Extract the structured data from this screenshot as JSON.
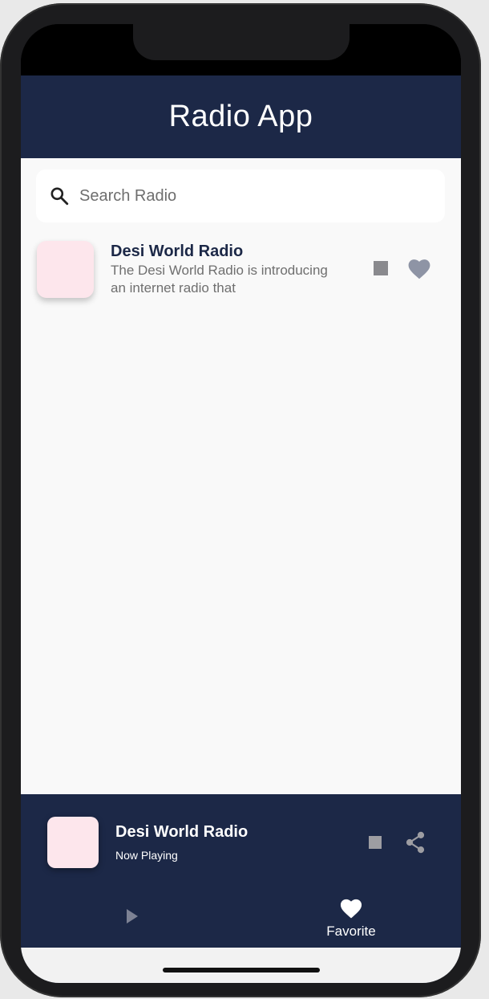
{
  "app": {
    "title": "Radio App"
  },
  "search": {
    "placeholder": "Search Radio"
  },
  "stations": [
    {
      "name": "Desi World Radio",
      "description": "The Desi World Radio is introducing an internet radio that",
      "icons": [
        "stop-icon",
        "heart-icon"
      ]
    }
  ],
  "player": {
    "title": "Desi World Radio",
    "status": "Now Playing",
    "icons": [
      "stop-icon",
      "share-icon"
    ]
  },
  "bottom_nav": {
    "items": [
      {
        "icon": "play-icon",
        "label": ""
      },
      {
        "icon": "heart-icon",
        "label": "Favorite"
      }
    ]
  },
  "colors": {
    "primary": "#1c2847",
    "background": "#f9f9f9",
    "thumbnail": "#fde6ec",
    "icon_gray": "#8a8a8e"
  }
}
